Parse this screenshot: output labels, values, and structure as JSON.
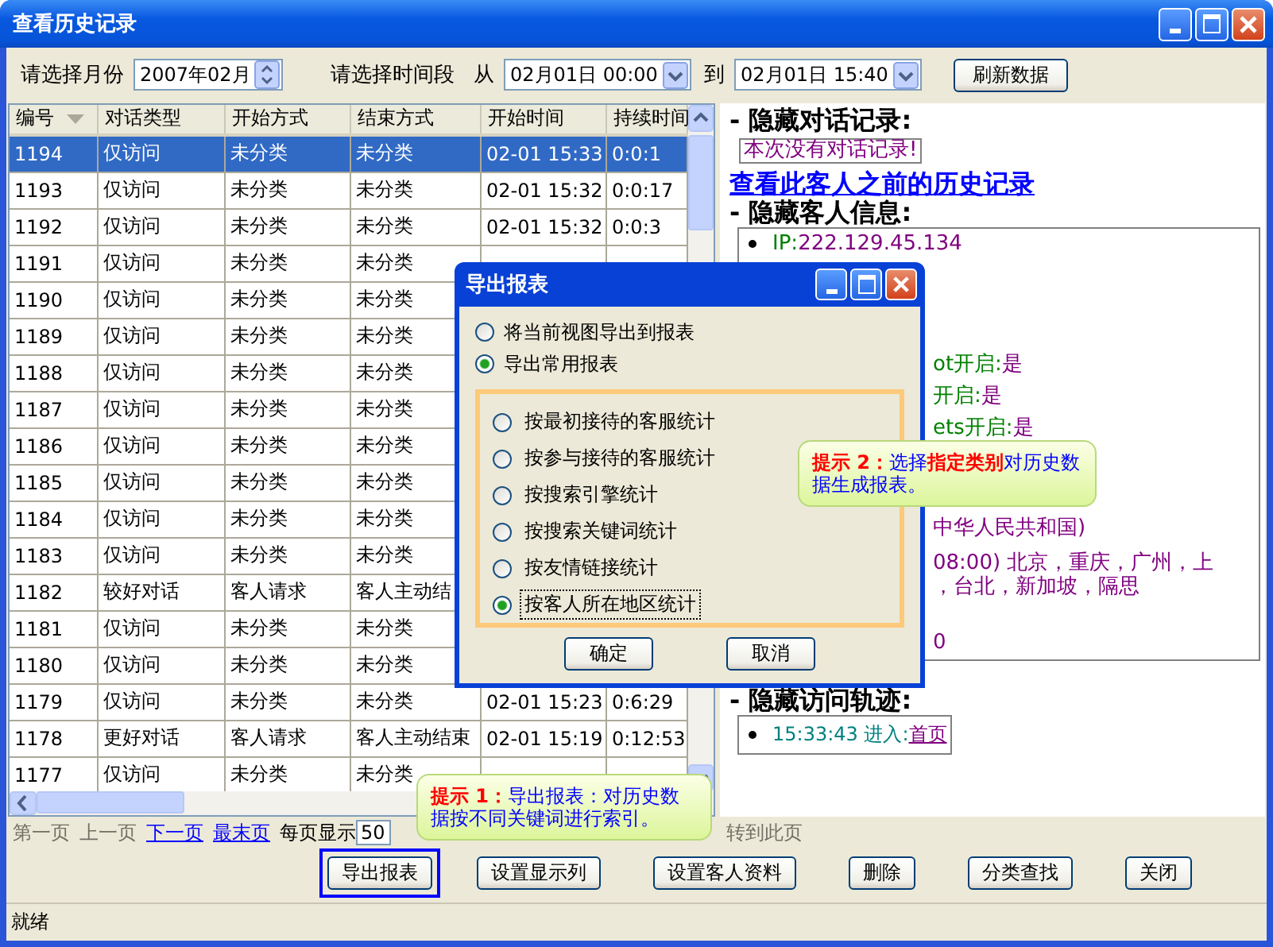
{
  "window": {
    "title": "查看历史记录"
  },
  "toolbar": {
    "month_label": "请选择月份",
    "month_value": "2007年02月",
    "range_label": "请选择时间段",
    "from_label": "从",
    "from_value": "02月01日 00:00",
    "to_label": "到",
    "to_value": "02月01日 15:40",
    "refresh_button": "刷新数据"
  },
  "table": {
    "columns": [
      {
        "label": "编号",
        "sorted": true
      },
      {
        "label": "对话类型",
        "sorted": false
      },
      {
        "label": "开始方式",
        "sorted": false
      },
      {
        "label": "结束方式",
        "sorted": false
      },
      {
        "label": "开始时间",
        "sorted": false
      },
      {
        "label": "持续时间",
        "sorted": false
      }
    ],
    "rows": [
      {
        "selected": true,
        "cells": [
          "1194",
          "仅访问",
          "未分类",
          "未分类",
          "02-01 15:33",
          "0:0:1"
        ]
      },
      {
        "selected": false,
        "cells": [
          "1193",
          "仅访问",
          "未分类",
          "未分类",
          "02-01 15:32",
          "0:0:17"
        ]
      },
      {
        "selected": false,
        "cells": [
          "1192",
          "仅访问",
          "未分类",
          "未分类",
          "02-01 15:32",
          "0:0:3"
        ]
      },
      {
        "selected": false,
        "cells": [
          "1191",
          "仅访问",
          "未分类",
          "未分类"
        ]
      },
      {
        "selected": false,
        "cells": [
          "1190",
          "仅访问",
          "未分类",
          "未分类"
        ]
      },
      {
        "selected": false,
        "cells": [
          "1189",
          "仅访问",
          "未分类",
          "未分类"
        ]
      },
      {
        "selected": false,
        "cells": [
          "1188",
          "仅访问",
          "未分类",
          "未分类"
        ]
      },
      {
        "selected": false,
        "cells": [
          "1187",
          "仅访问",
          "未分类",
          "未分类"
        ]
      },
      {
        "selected": false,
        "cells": [
          "1186",
          "仅访问",
          "未分类",
          "未分类"
        ]
      },
      {
        "selected": false,
        "cells": [
          "1185",
          "仅访问",
          "未分类",
          "未分类"
        ]
      },
      {
        "selected": false,
        "cells": [
          "1184",
          "仅访问",
          "未分类",
          "未分类"
        ]
      },
      {
        "selected": false,
        "cells": [
          "1183",
          "仅访问",
          "未分类",
          "未分类"
        ]
      },
      {
        "selected": false,
        "cells": [
          "1182",
          "较好对话",
          "客人请求",
          "客人主动结"
        ]
      },
      {
        "selected": false,
        "cells": [
          "1181",
          "仅访问",
          "未分类",
          "未分类"
        ]
      },
      {
        "selected": false,
        "cells": [
          "1180",
          "仅访问",
          "未分类",
          "未分类"
        ]
      },
      {
        "selected": false,
        "cells": [
          "1179",
          "仅访问",
          "未分类",
          "未分类",
          "02-01 15:23",
          "0:6:29"
        ]
      },
      {
        "selected": false,
        "cells": [
          "1178",
          "更好对话",
          "客人请求",
          "客人主动结束",
          "02-01 15:19",
          "0:12:53"
        ]
      },
      {
        "selected": false,
        "cells": [
          "1177",
          "仅访问",
          "未分类",
          "未分类"
        ]
      }
    ]
  },
  "detail": {
    "chat_heading": "- 隐藏对话记录:",
    "no_chat": "本次没有对话记录!",
    "history_link": "查看此客人之前的历史记录",
    "info_heading": "- 隐藏客人信息:",
    "info_lines": [
      {
        "label": "IP:",
        "value": "222.129.45.134"
      },
      {
        "label": "ot开启:",
        "value": "是"
      },
      {
        "label": "开启:",
        "value": "是"
      },
      {
        "label": "ets开启:",
        "value": "是"
      },
      {
        "value": "中华人民共和国)"
      },
      {
        "value": "08:00) 北京，重庆，广州，上"
      },
      {
        "value": "，台北，新加坡，隔思"
      },
      {
        "value": "0"
      }
    ],
    "track_heading": "- 隐藏访问轨迹:",
    "track": [
      {
        "time": "15:33:43 进入:",
        "page": "首页"
      }
    ]
  },
  "pager": {
    "links": [
      {
        "label": "第一页",
        "disabled": true
      },
      {
        "label": "上一页",
        "disabled": true
      },
      {
        "label": "下一页",
        "disabled": false
      },
      {
        "label": "最末页",
        "disabled": false
      }
    ],
    "per_page_label": "每页显示",
    "per_page_value": "50",
    "goto": "转到此页"
  },
  "buttons": [
    {
      "label": "导出报表",
      "focused": true
    },
    {
      "label": "设置显示列",
      "focused": false
    },
    {
      "label": "设置客人资料",
      "focused": false
    },
    {
      "label": "删除",
      "focused": false
    },
    {
      "label": "分类查找",
      "focused": false
    },
    {
      "label": "关闭",
      "focused": false
    }
  ],
  "status_bar": "就绪",
  "dialog": {
    "title": "导出报表",
    "options": [
      {
        "label": "将当前视图导出到报表",
        "selected": false
      },
      {
        "label": "导出常用报表",
        "selected": true
      }
    ],
    "report_types": [
      {
        "label": "按最初接待的客服统计",
        "selected": false,
        "focused": false
      },
      {
        "label": "按参与接待的客服统计",
        "selected": false,
        "focused": false
      },
      {
        "label": "按搜索引擎统计",
        "selected": false,
        "focused": false
      },
      {
        "label": "按搜索关键词统计",
        "selected": false,
        "focused": false
      },
      {
        "label": "按友情链接统计",
        "selected": false,
        "focused": false
      },
      {
        "label": "按客人所在地区统计",
        "selected": true,
        "focused": true
      }
    ],
    "buttons": [
      "确定",
      "取消"
    ]
  },
  "tips": [
    {
      "text": "**提示 1：**导出报表：对历史数据按不同关键词进行索引。"
    },
    {
      "text": "**提示 2：**选择**指定类别**对历史数据生成报表。"
    }
  ]
}
